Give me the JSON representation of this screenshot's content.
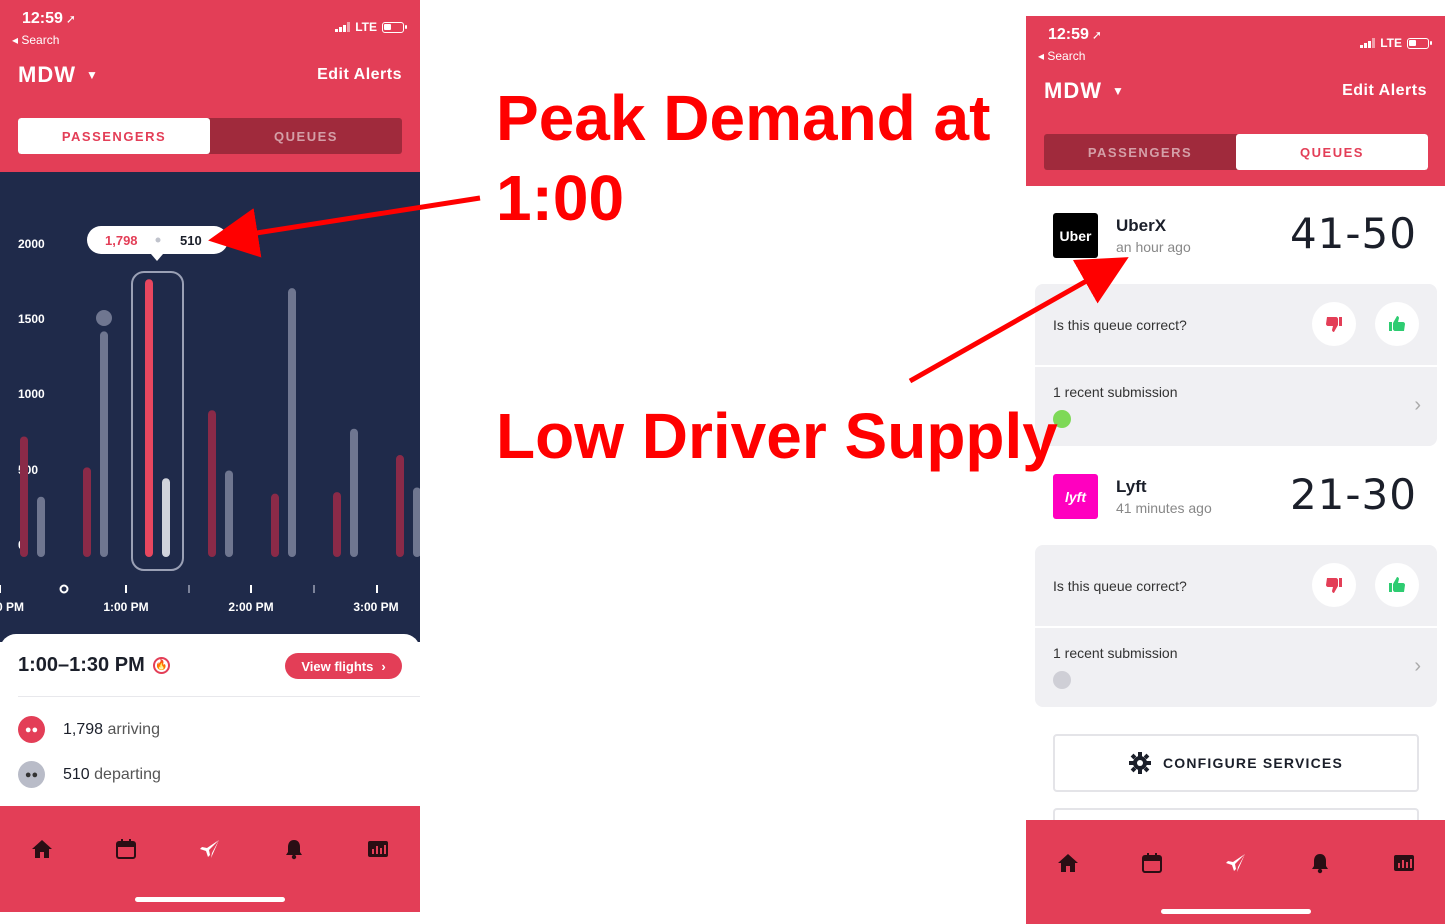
{
  "left_phone": {
    "status": {
      "time": "12:59",
      "back": "◂ Search",
      "carrier": "LTE"
    },
    "header": {
      "airport": "MDW",
      "edit_alerts": "Edit Alerts"
    },
    "segments": [
      {
        "label": "PASSENGERS",
        "active": true
      },
      {
        "label": "QUEUES",
        "active": false
      }
    ],
    "chart_data": {
      "type": "bar",
      "y_ticks": [
        "2000",
        "1500",
        "1000",
        "500",
        "0"
      ],
      "ylim": [
        0,
        2000
      ],
      "x_tick_labels": [
        "0 PM",
        "1:00 PM",
        "2:00 PM",
        "3:00 PM"
      ],
      "series": [
        {
          "name": "arriving",
          "color": "#e33e57",
          "values": [
            780,
            580,
            1798,
            950,
            410,
            420,
            660
          ]
        },
        {
          "name": "departing",
          "color": "#8b93a8",
          "values": [
            390,
            1460,
            510,
            560,
            1740,
            830,
            450
          ]
        }
      ],
      "highlight_index": 2,
      "tooltip": {
        "arriving": "1,798",
        "departing": "510"
      }
    },
    "info": {
      "slot": "1:00–1:30 PM",
      "view_flights": "View flights",
      "arriving": {
        "count": "1,798",
        "label": "arriving"
      },
      "departing": {
        "count": "510",
        "label": "departing"
      }
    },
    "tabs": [
      "home-icon",
      "calendar-icon",
      "plane-icon",
      "bell-icon",
      "stats-icon"
    ]
  },
  "right_phone": {
    "status": {
      "time": "12:59",
      "back": "◂ Search",
      "carrier": "LTE"
    },
    "header": {
      "airport": "MDW",
      "edit_alerts": "Edit Alerts"
    },
    "segments": [
      {
        "label": "PASSENGERS",
        "active": false
      },
      {
        "label": "QUEUES",
        "active": true
      }
    ],
    "queues": [
      {
        "service": "UberX",
        "logo": "Uber",
        "logo_color": "#000000",
        "updated": "an hour ago",
        "range": "41-50",
        "question": "Is this queue correct?",
        "submissions": "1 recent submission"
      },
      {
        "service": "Lyft",
        "logo": "lyft",
        "logo_color": "#ff00bf",
        "updated": "41 minutes ago",
        "range": "21-30",
        "question": "Is this queue correct?",
        "submissions": "1 recent submission"
      }
    ],
    "configure": "CONFIGURE SERVICES",
    "tabs": [
      "home-icon",
      "calendar-icon",
      "plane-icon",
      "bell-icon",
      "stats-icon"
    ]
  },
  "annotations": {
    "peak": "Peak Demand at 1:00",
    "low": "Low Driver Supply"
  },
  "colors": {
    "brand": "#e33e57",
    "chart_bg": "#1f2a4a",
    "annotation": "#ff0000",
    "thumb_up": "#2ecc71"
  }
}
